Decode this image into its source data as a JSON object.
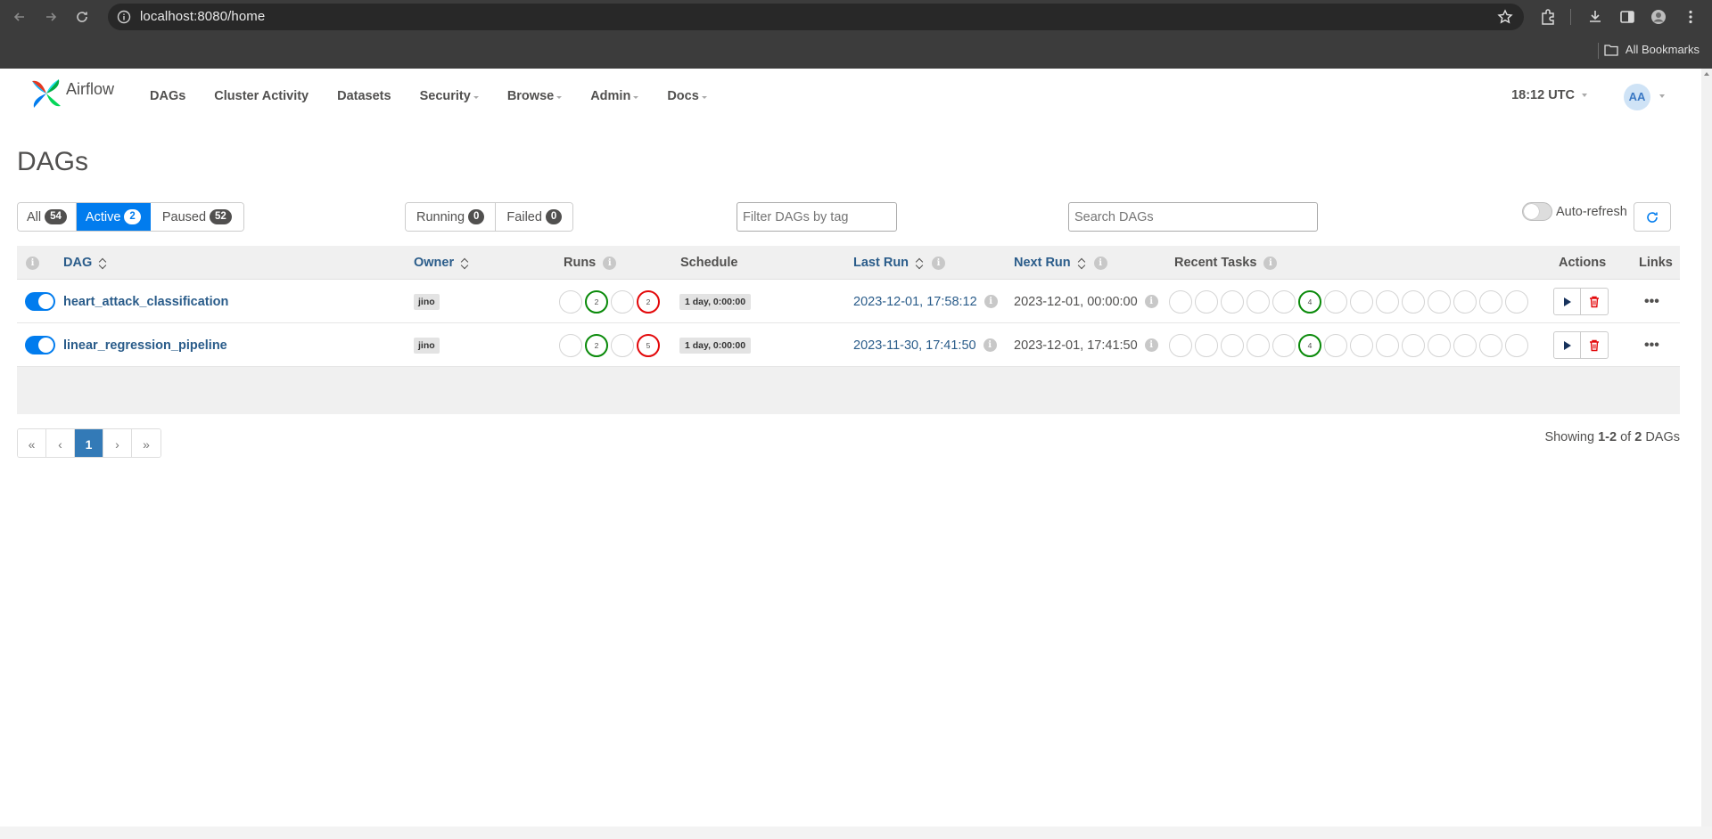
{
  "browser": {
    "url": "localhost:8080/home",
    "bookmarks_label": "All Bookmarks"
  },
  "navbar": {
    "brand": "Airflow",
    "menu": [
      {
        "label": "DAGs",
        "caret": false
      },
      {
        "label": "Cluster Activity",
        "caret": false
      },
      {
        "label": "Datasets",
        "caret": false
      },
      {
        "label": "Security",
        "caret": true
      },
      {
        "label": "Browse",
        "caret": true
      },
      {
        "label": "Admin",
        "caret": true
      },
      {
        "label": "Docs",
        "caret": true
      }
    ],
    "clock": "18:12 UTC",
    "avatar": "AA"
  },
  "page": {
    "title": "DAGs"
  },
  "status_filter": {
    "all_label": "All",
    "all_count": "54",
    "active_label": "Active",
    "active_count": "2",
    "paused_label": "Paused",
    "paused_count": "52"
  },
  "run_filter": {
    "running_label": "Running",
    "running_count": "0",
    "failed_label": "Failed",
    "failed_count": "0"
  },
  "tag_filter_placeholder": "Filter DAGs by tag",
  "search_placeholder": "Search DAGs",
  "auto_refresh_label": "Auto-refresh",
  "table": {
    "headers": {
      "dag": "DAG",
      "owner": "Owner",
      "runs": "Runs",
      "schedule": "Schedule",
      "last_run": "Last Run",
      "next_run": "Next Run",
      "recent_tasks": "Recent Tasks",
      "actions": "Actions",
      "links": "Links"
    },
    "rows": [
      {
        "dag_id": "heart_attack_classification",
        "paused": false,
        "owner": "jino",
        "runs": [
          "",
          "2",
          "",
          "2"
        ],
        "run_states": [
          "none",
          "success",
          "none",
          "failed"
        ],
        "schedule": "1 day, 0:00:00",
        "last_run": "2023-12-01, 17:58:12",
        "next_run": "2023-12-01, 00:00:00",
        "recent_tasks": [
          "",
          "",
          "",
          "",
          "",
          "4",
          "",
          "",
          "",
          "",
          "",
          "",
          "",
          ""
        ],
        "recent_task_states": [
          "none",
          "none",
          "none",
          "none",
          "none",
          "success",
          "none",
          "none",
          "none",
          "none",
          "none",
          "none",
          "none",
          "none"
        ]
      },
      {
        "dag_id": "linear_regression_pipeline",
        "paused": false,
        "owner": "jino",
        "runs": [
          "",
          "2",
          "",
          "5"
        ],
        "run_states": [
          "none",
          "success",
          "none",
          "failed"
        ],
        "schedule": "1 day, 0:00:00",
        "last_run": "2023-11-30, 17:41:50",
        "next_run": "2023-12-01, 17:41:50",
        "recent_tasks": [
          "",
          "",
          "",
          "",
          "",
          "4",
          "",
          "",
          "",
          "",
          "",
          "",
          "",
          ""
        ],
        "recent_task_states": [
          "none",
          "none",
          "none",
          "none",
          "none",
          "success",
          "none",
          "none",
          "none",
          "none",
          "none",
          "none",
          "none",
          "none"
        ]
      }
    ]
  },
  "pagination": {
    "first": "«",
    "prev": "‹",
    "current": "1",
    "next": "›",
    "last": "»",
    "showing_prefix": "Showing",
    "showing_range": "1-2",
    "showing_of": "of",
    "showing_total": "2",
    "showing_suffix": "DAGs"
  },
  "colors": {
    "accent": "#017cee",
    "success": "#0a8a0a",
    "failed": "#e3080a",
    "link": "#2a5c8a"
  }
}
